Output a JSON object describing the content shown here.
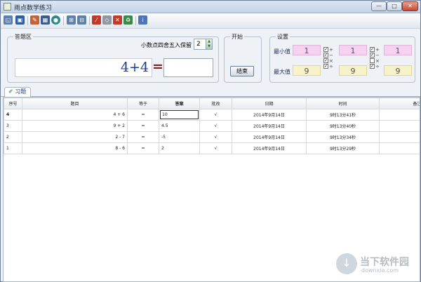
{
  "window": {
    "title": "雨点数学练习",
    "controls": [
      "—",
      "□",
      "✕"
    ]
  },
  "toolbar": {
    "icons": [
      "preview-icon",
      "save-icon",
      "export-icon",
      "calendar-icon",
      "stop-icon",
      "tree-icon",
      "tree-add-icon",
      "brush-icon",
      "eraser-icon",
      "delete-icon",
      "recycle-icon",
      "info-icon"
    ]
  },
  "answer_area": {
    "group_title": "答题区",
    "round_label": "小数点四舍五入保留",
    "round_value": "2",
    "question": "4+4",
    "equals": "=",
    "answer_value": ""
  },
  "start_area": {
    "group_title": "开始",
    "end_button": "结束"
  },
  "settings": {
    "group_title": "设置",
    "min_label": "最小值",
    "max_label": "最大值",
    "min_values": [
      "1",
      "1",
      "1"
    ],
    "max_values": [
      "9",
      "9",
      "9"
    ],
    "operators": [
      [
        {
          "glyph": "+",
          "checked": true
        },
        {
          "glyph": "−",
          "checked": true
        },
        {
          "glyph": "×",
          "checked": true
        },
        {
          "glyph": "÷",
          "checked": true
        }
      ],
      [
        {
          "glyph": "+",
          "checked": true
        },
        {
          "glyph": "−",
          "checked": true
        },
        {
          "glyph": "×",
          "checked": false
        },
        {
          "glyph": "÷",
          "checked": true
        }
      ]
    ]
  },
  "tab": {
    "label": "习题"
  },
  "table": {
    "columns": [
      "序号",
      "题目",
      "等于",
      "答案",
      "批改",
      "日期",
      "时间",
      "备注",
      "存盘"
    ],
    "rows": [
      {
        "id": "4",
        "question": "4 + 6",
        "eq": "=",
        "answer": "10",
        "mark": "√",
        "date": "2014年9月14日",
        "time": "9时13分41秒",
        "note": "",
        "save": "1"
      },
      {
        "id": "3",
        "question": "9 + 2",
        "eq": "=",
        "answer": "4.5",
        "mark": "√",
        "date": "2014年9月14日",
        "time": "9时13分40秒",
        "note": "",
        "save": "1"
      },
      {
        "id": "2",
        "question": "2 - 7",
        "eq": "=",
        "answer": "-5",
        "mark": "√",
        "date": "2014年9月14日",
        "time": "9时13分34秒",
        "note": "",
        "save": "1"
      },
      {
        "id": "1",
        "question": "8 - 6",
        "eq": "=",
        "answer": "2",
        "mark": "√",
        "date": "2014年9月14日",
        "time": "9时13分29秒",
        "note": "",
        "save": "1"
      }
    ]
  },
  "watermark": {
    "text": "当下软件园",
    "url": "downxia.com"
  }
}
